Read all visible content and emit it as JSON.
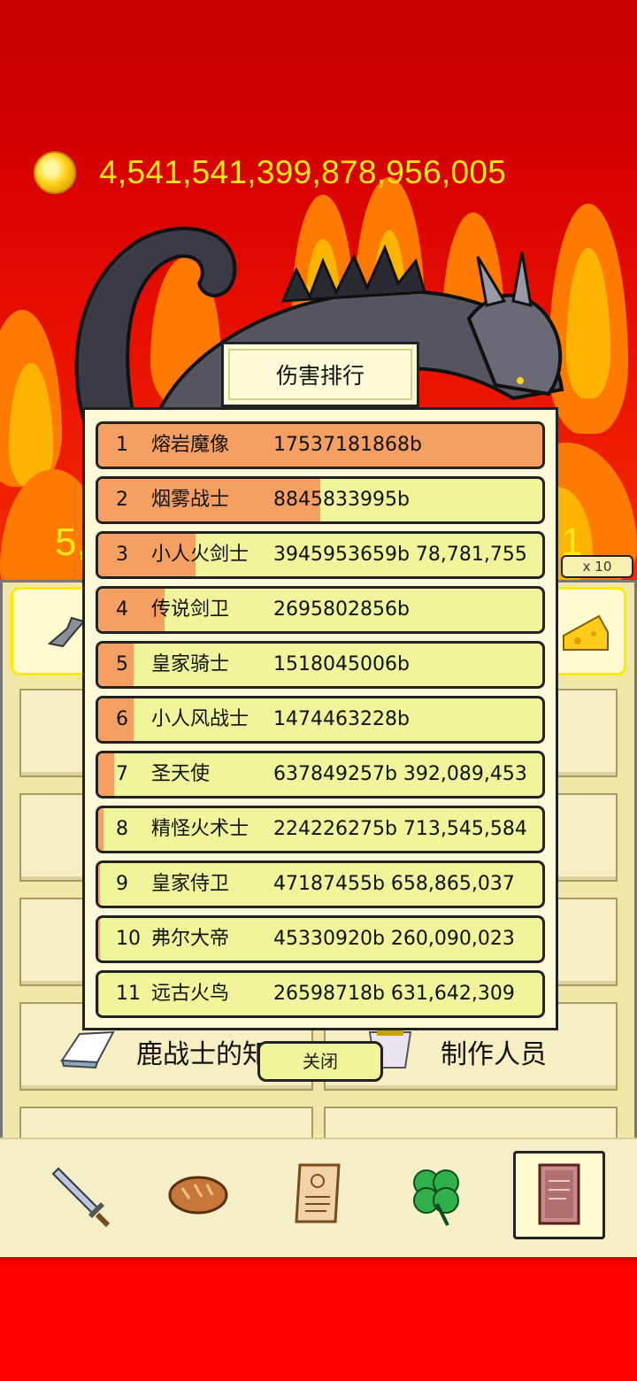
{
  "hud": {
    "coins": "4,541,541,399,878,956,005",
    "side_left": "5,",
    "side_right": "1",
    "multiplier": "x 10"
  },
  "menu": {
    "item_knowledge": "鹿战士的知识",
    "item_credits": "制作人员"
  },
  "modal": {
    "title": "伤害排行",
    "close_label": "关闭",
    "rows": [
      {
        "rank": "1",
        "name": "熔岩魔像",
        "damage": "17537181868b",
        "fill_percent": 100
      },
      {
        "rank": "2",
        "name": "烟雾战士",
        "damage": "8845833995b",
        "fill_percent": 50
      },
      {
        "rank": "3",
        "name": "小人火剑士",
        "damage": "3945953659b 78,781,755",
        "fill_percent": 22
      },
      {
        "rank": "4",
        "name": "传说剑卫",
        "damage": "2695802856b",
        "fill_percent": 15
      },
      {
        "rank": "5",
        "name": "皇家骑士",
        "damage": "1518045006b",
        "fill_percent": 8
      },
      {
        "rank": "6",
        "name": "小人风战士",
        "damage": "1474463228b",
        "fill_percent": 8
      },
      {
        "rank": "7",
        "name": "圣天使",
        "damage": "637849257b 392,089,453",
        "fill_percent": 3.5
      },
      {
        "rank": "8",
        "name": "精怪火术士",
        "damage": "224226275b 713,545,584",
        "fill_percent": 1.2
      },
      {
        "rank": "9",
        "name": "皇家侍卫",
        "damage": "47187455b 658,865,037",
        "fill_percent": 0.3
      },
      {
        "rank": "10",
        "name": "弗尔大帝",
        "damage": "45330920b 260,090,023",
        "fill_percent": 0.3
      },
      {
        "rank": "11",
        "name": "远古火鸟",
        "damage": "26598718b 631,642,309",
        "fill_percent": 0.2
      }
    ]
  },
  "bottom_nav": [
    {
      "icon": "sword-icon",
      "active": false
    },
    {
      "icon": "bread-icon",
      "active": false
    },
    {
      "icon": "scroll-icon",
      "active": false
    },
    {
      "icon": "clover-icon",
      "active": false
    },
    {
      "icon": "book-icon",
      "active": true
    }
  ],
  "colors": {
    "bar_fill": "#f5a062",
    "row_bg": "#eff59a",
    "coin_text": "#ffe81a",
    "background_red": "#e81000"
  }
}
